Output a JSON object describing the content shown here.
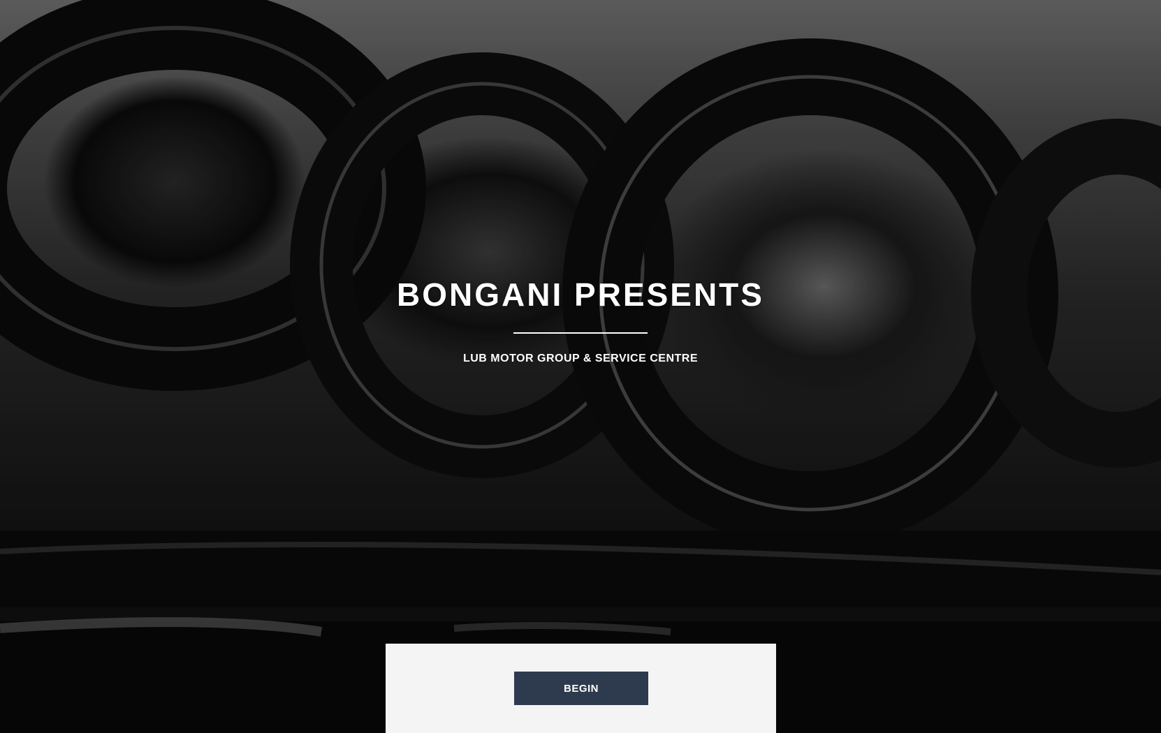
{
  "hero": {
    "title": "BONGANI PRESENTS",
    "subtitle": "LUB MOTOR GROUP & SERVICE CENTRE",
    "background_image": "wrenches-monochrome-photo"
  },
  "actions": {
    "begin_label": "BEGIN"
  },
  "colors": {
    "button_bg": "#2e3b4e",
    "panel_bg": "#f4f4f4",
    "text": "#ffffff"
  }
}
